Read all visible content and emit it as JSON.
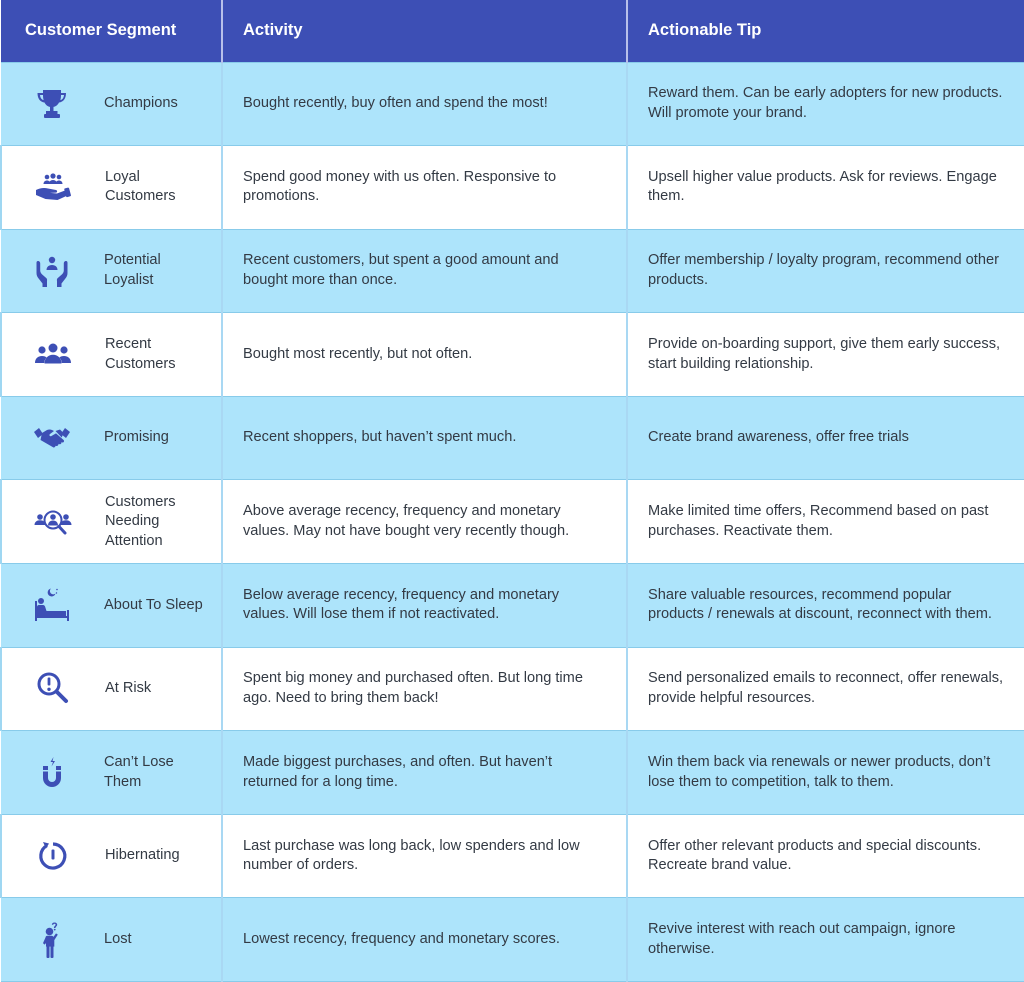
{
  "header": {
    "col1": "Customer Segment",
    "col2": "Activity",
    "col3": "Actionable Tip"
  },
  "colors": {
    "header_bg": "#3d4fb5",
    "icon": "#3d4fb5",
    "row_blue": "#ade4fb",
    "row_white": "#ffffff"
  },
  "rows": [
    {
      "icon": "trophy-icon",
      "segment": "Champions",
      "activity": "Bought recently, buy often and spend the most!",
      "tip": "Reward them. Can be early adopters for new products. Will promote your brand."
    },
    {
      "icon": "hand-holding-people-icon",
      "segment": "Loyal Customers",
      "activity": "Spend good money with us often. Responsive to promotions.",
      "tip": "Upsell higher value products. Ask for reviews. Engage them."
    },
    {
      "icon": "hands-person-icon",
      "segment": "Potential Loyalist",
      "activity": "Recent customers, but spent a good amount and bought more than once.",
      "tip": "Offer membership / loyalty program, recommend other products."
    },
    {
      "icon": "group-icon",
      "segment": "Recent Customers",
      "activity": "Bought most recently, but not often.",
      "tip": "Provide on-boarding support, give them early success, start building relationship."
    },
    {
      "icon": "handshake-icon",
      "segment": "Promising",
      "activity": "Recent shoppers, but haven’t spent much.",
      "tip": "Create brand awareness, offer free trials"
    },
    {
      "icon": "people-magnifier-icon",
      "segment": "Customers Needing Attention",
      "activity": "Above average recency, frequency and monetary values. May not have bought very recently though.",
      "tip": "Make limited time offers, Recommend based on past purchases. Reactivate them."
    },
    {
      "icon": "sleeping-bed-icon",
      "segment": "About To Sleep",
      "activity": "Below average recency, frequency and monetary values. Will lose them if not reactivated.",
      "tip": "Share valuable resources, recommend popular products / renewals at discount, reconnect with them."
    },
    {
      "icon": "alert-magnifier-icon",
      "segment": "At Risk",
      "activity": "Spent big money and purchased often. But long time ago. Need to bring them back!",
      "tip": "Send personalized emails to reconnect, offer renewals, provide helpful resources."
    },
    {
      "icon": "magnet-icon",
      "segment": "Can’t Lose Them",
      "activity": "Made biggest purchases, and often. But haven’t returned for a long time.",
      "tip": "Win them back via renewals or newer products, don’t lose them to competition, talk to them."
    },
    {
      "icon": "power-cycle-icon",
      "segment": "Hibernating",
      "activity": "Last purchase was long back, low spenders and low number of orders.",
      "tip": "Offer other relevant products and special discounts. Recreate brand value."
    },
    {
      "icon": "confused-person-icon",
      "segment": "Lost",
      "activity": "Lowest recency, frequency and monetary scores.",
      "tip": "Revive interest with reach out campaign, ignore otherwise."
    }
  ]
}
